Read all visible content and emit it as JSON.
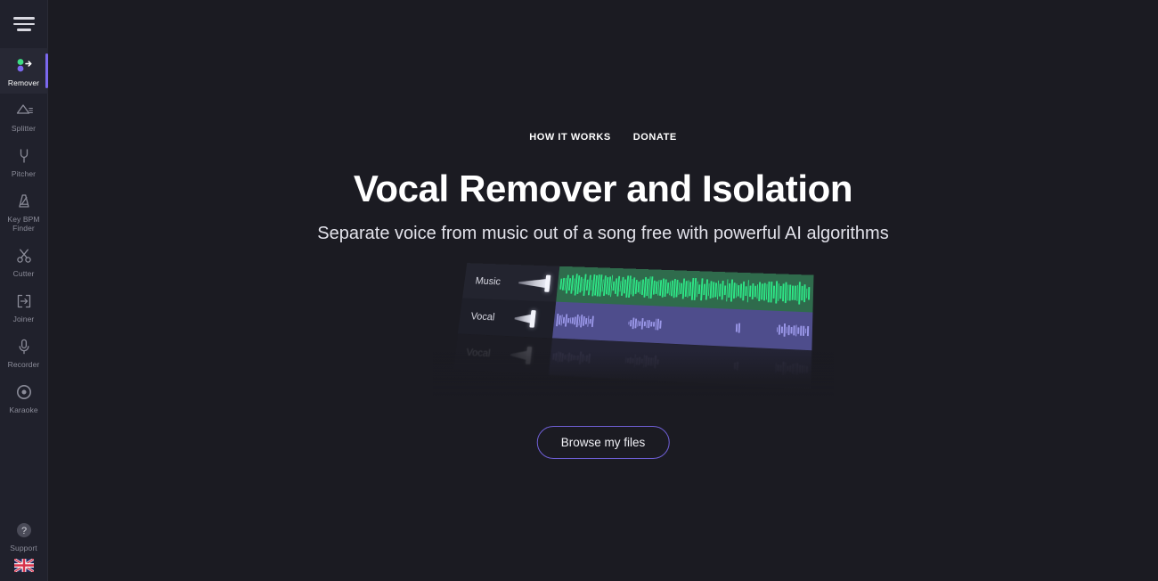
{
  "sidebar": {
    "menu_icon": "hamburger-icon",
    "items": [
      {
        "id": "remover",
        "label": "Remover",
        "icon": "remover-icon",
        "active": true
      },
      {
        "id": "splitter",
        "label": "Splitter",
        "icon": "prism-icon",
        "active": false
      },
      {
        "id": "pitcher",
        "label": "Pitcher",
        "icon": "tuning-fork-icon",
        "active": false
      },
      {
        "id": "keybpm",
        "label": "Key BPM\nFinder",
        "icon": "metronome-icon",
        "active": false
      },
      {
        "id": "cutter",
        "label": "Cutter",
        "icon": "scissors-icon",
        "active": false
      },
      {
        "id": "joiner",
        "label": "Joiner",
        "icon": "join-icon",
        "active": false
      },
      {
        "id": "recorder",
        "label": "Recorder",
        "icon": "microphone-icon",
        "active": false
      },
      {
        "id": "karaoke",
        "label": "Karaoke",
        "icon": "disc-icon",
        "active": false
      }
    ],
    "support": {
      "label": "Support",
      "icon": "question-circle-icon"
    },
    "language": {
      "code": "EN",
      "icon": "uk-flag-icon"
    },
    "accent_color": "#7b68ee"
  },
  "topnav": {
    "links": [
      {
        "id": "how-it-works",
        "label": "HOW IT WORKS"
      },
      {
        "id": "donate",
        "label": "DONATE"
      }
    ]
  },
  "hero": {
    "title": "Vocal Remover and Isolation",
    "subtitle": "Separate voice from music out of a song free with powerful AI algorithms"
  },
  "illustration": {
    "tracks": [
      {
        "id": "music",
        "label": "Music",
        "wave_color": "#2ee686",
        "track_color": "#2f6b4c"
      },
      {
        "id": "vocal",
        "label": "Vocal",
        "wave_color": "#9a97e8",
        "track_color": "#4e4d8c"
      },
      {
        "id": "vocal-ghost",
        "label": "Vocal",
        "wave_color": "#9a97e8",
        "track_color": "#4e4d8c"
      }
    ]
  },
  "cta": {
    "label": "Browse my files",
    "border_color": "#6f5fd6"
  },
  "theme": {
    "background": "#1b1b22",
    "sidebar_background": "#20212c",
    "text": "#ffffff"
  }
}
